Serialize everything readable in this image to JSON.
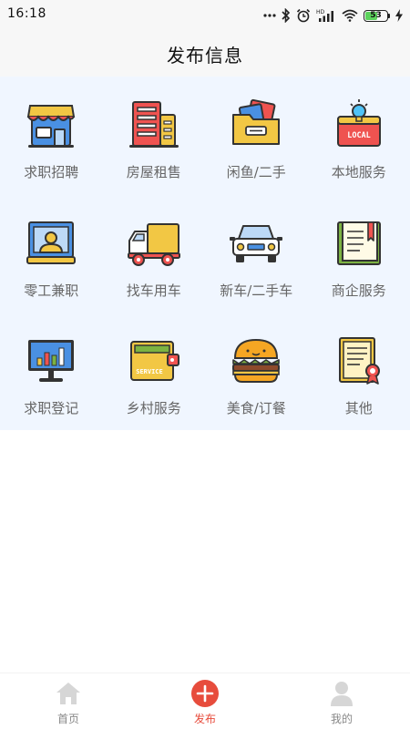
{
  "status_bar": {
    "time": "16:18",
    "battery": "53",
    "battery_level_percent": 53,
    "icons": [
      "dots-icon",
      "bluetooth-icon",
      "alarm-icon",
      "signal-icon",
      "wifi-icon",
      "battery-icon",
      "charging-icon"
    ],
    "hd_label": "HD"
  },
  "header": {
    "title": "发布信息"
  },
  "categories": [
    {
      "label": "求职招聘",
      "icon": "shop-icon"
    },
    {
      "label": "房屋租售",
      "icon": "building-icon"
    },
    {
      "label": "闲鱼/二手",
      "icon": "folder-icon"
    },
    {
      "label": "本地服务",
      "icon": "local-service-icon",
      "icon_text": "LOCAL"
    },
    {
      "label": "零工兼职",
      "icon": "worker-icon"
    },
    {
      "label": "找车用车",
      "icon": "truck-icon"
    },
    {
      "label": "新车/二手车",
      "icon": "car-icon"
    },
    {
      "label": "商企服务",
      "icon": "notebook-icon"
    },
    {
      "label": "求职登记",
      "icon": "monitor-chart-icon"
    },
    {
      "label": "乡村服务",
      "icon": "wallet-icon",
      "icon_text": "SERVICE"
    },
    {
      "label": "美食/订餐",
      "icon": "burger-icon"
    },
    {
      "label": "其他",
      "icon": "certificate-icon"
    }
  ],
  "tabbar": {
    "tabs": [
      {
        "label": "首页",
        "icon": "home-icon",
        "active": false
      },
      {
        "label": "发布",
        "icon": "plus-icon",
        "active": true
      },
      {
        "label": "我的",
        "icon": "user-icon",
        "active": false
      }
    ],
    "active_color": "#e74c3c",
    "inactive_color": "#888888"
  },
  "colors": {
    "grid_background": "#f0f6ff",
    "header_background": "#f7f7f7",
    "accent": "#e74c3c"
  }
}
